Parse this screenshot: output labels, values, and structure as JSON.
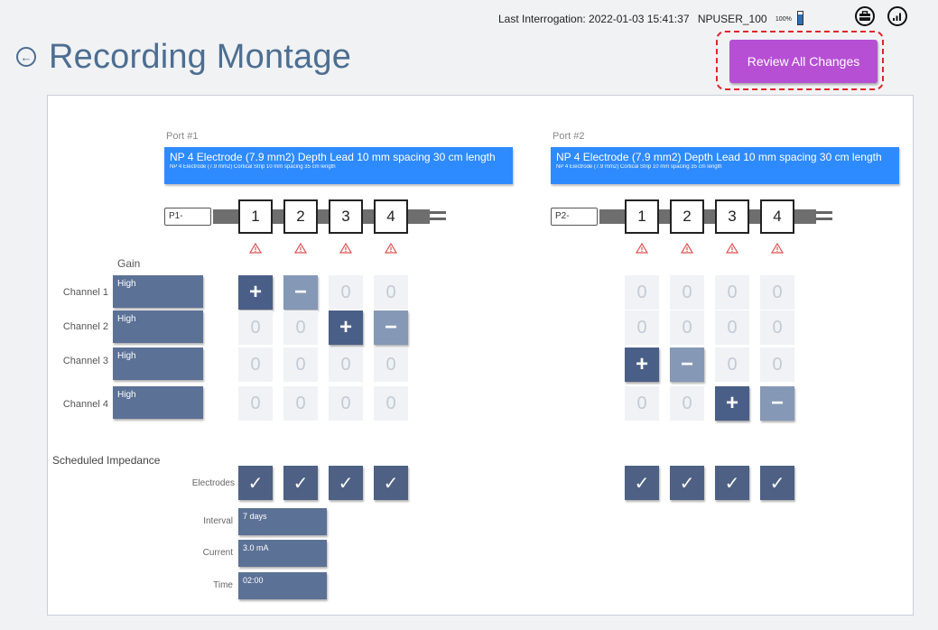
{
  "status": {
    "last_interrogation": "Last Interrogation: 2022-01-03 15:41:37",
    "user": "NPUSER_100",
    "battery_pct": "100%"
  },
  "page_title": "Recording Montage",
  "review_button": "Review All Changes",
  "ports": [
    {
      "label": "Port #1",
      "lead_main": "NP 4 Electrode (7.9 mm2) Depth Lead 10 mm spacing 30 cm length",
      "lead_sub": "NP 4 Electrode (7.9 mm2) Cortical Strip 10 mm spacing 35 cm length",
      "field": "P1-",
      "electrodes": [
        "1",
        "2",
        "3",
        "4"
      ],
      "channels": [
        [
          "+",
          "−",
          "0",
          "0"
        ],
        [
          "0",
          "0",
          "+",
          "−"
        ],
        [
          "0",
          "0",
          "0",
          "0"
        ],
        [
          "0",
          "0",
          "0",
          "0"
        ]
      ]
    },
    {
      "label": "Port #2",
      "lead_main": "NP 4 Electrode (7.9 mm2) Depth Lead 10 mm spacing 30 cm length",
      "lead_sub": "NP 4 Electrode (7.9 mm2) Cortical Strip 10 mm spacing 35 cm length",
      "field": "P2-",
      "electrodes": [
        "1",
        "2",
        "3",
        "4"
      ],
      "channels": [
        [
          "0",
          "0",
          "0",
          "0"
        ],
        [
          "0",
          "0",
          "0",
          "0"
        ],
        [
          "+",
          "−",
          "0",
          "0"
        ],
        [
          "0",
          "0",
          "+",
          "−"
        ]
      ]
    }
  ],
  "gain_header": "Gain",
  "channels": [
    {
      "label": "Channel 1",
      "gain": "High"
    },
    {
      "label": "Channel 2",
      "gain": "High"
    },
    {
      "label": "Channel 3",
      "gain": "High"
    },
    {
      "label": "Channel 4",
      "gain": "High"
    }
  ],
  "scheduled": {
    "title": "Scheduled Impedance",
    "electrodes_label": "Electrodes",
    "check_glyph": "✓",
    "interval_label": "Interval",
    "interval_value": "7 days",
    "current_label": "Current",
    "current_value": "3.0 mA",
    "time_label": "Time",
    "time_value": "02:00"
  },
  "icons": {
    "back": "back-arrow-icon",
    "warning": "warning-icon",
    "briefcase": "briefcase-icon",
    "signal": "signal-icon",
    "battery": "battery-icon"
  },
  "colors": {
    "title": "#4d6e92",
    "review_button": "#b64fd4",
    "lead_bar": "#2e8bff",
    "gain_button": "#5c7196",
    "plus": "#4a5f87",
    "minus": "#8598b6",
    "warning": "#e05050"
  }
}
